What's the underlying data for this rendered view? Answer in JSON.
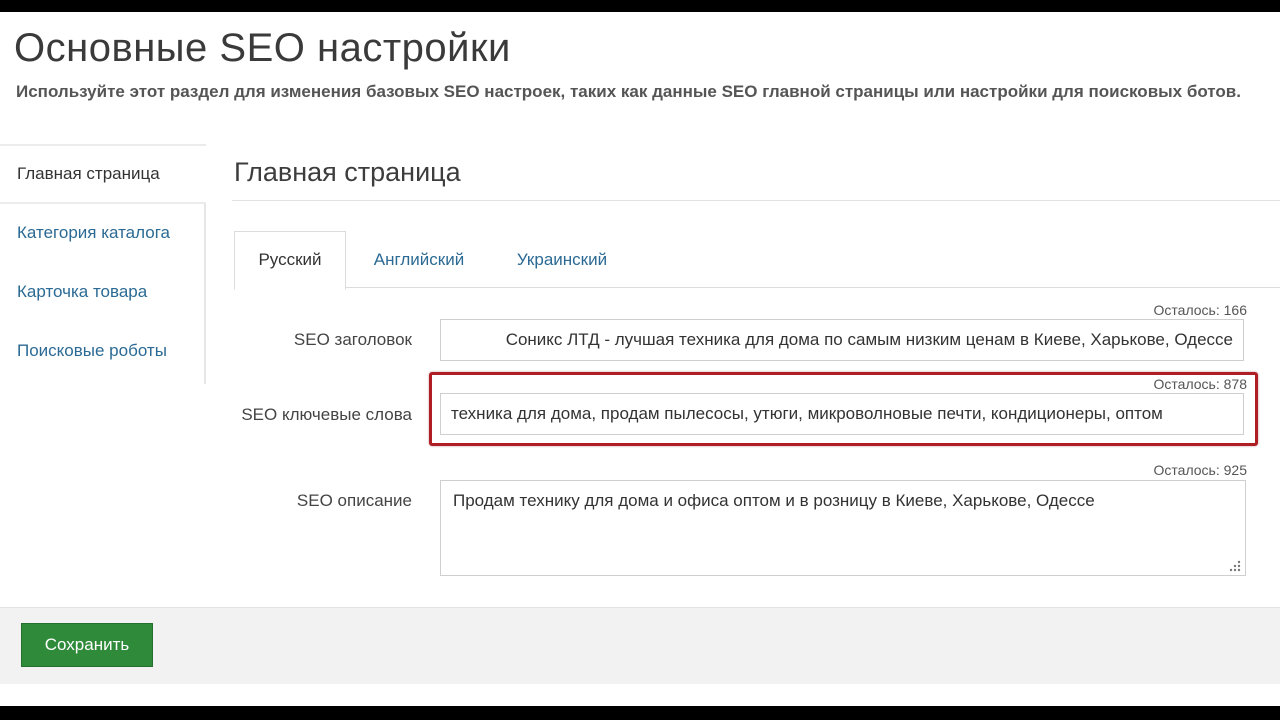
{
  "header": {
    "title": "Основные SEO настройки",
    "subtitle": "Используйте этот раздел для изменения базовых SEO настроек, таких как данные SEO главной страницы или настройки для поисковых ботов."
  },
  "sidebar": {
    "items": [
      {
        "label": "Главная страница",
        "active": true
      },
      {
        "label": "Категория каталога",
        "active": false
      },
      {
        "label": "Карточка товара",
        "active": false
      },
      {
        "label": "Поисковые роботы",
        "active": false
      }
    ]
  },
  "main": {
    "section_title": "Главная страница",
    "tabs": [
      {
        "label": "Русский",
        "active": true
      },
      {
        "label": "Английский",
        "active": false
      },
      {
        "label": "Украинский",
        "active": false
      }
    ],
    "fields": {
      "seo_title": {
        "label": "SEO заголовок",
        "counter": "Осталось: 166",
        "value": "Соникс ЛТД - лучшая техника для дома по самым низким ценам в Киеве, Харькове, Одессе"
      },
      "seo_keywords": {
        "label": "SEO ключевые слова",
        "counter": "Осталось: 878",
        "value": "техника для дома, продам пылесосы, утюги, микроволновые печти, кондиционеры, оптом"
      },
      "seo_description": {
        "label": "SEO описание",
        "counter": "Осталось: 925",
        "value": "Продам технику для дома и офиса оптом и в розницу в Киеве, Харькове, Одессе"
      }
    }
  },
  "footer": {
    "save_label": "Сохранить"
  },
  "colors": {
    "link": "#2b6a94",
    "save_button": "#2f8a3a",
    "highlight": "#b01e25"
  },
  "icons": {
    "resize": "resize-handle-icon"
  }
}
